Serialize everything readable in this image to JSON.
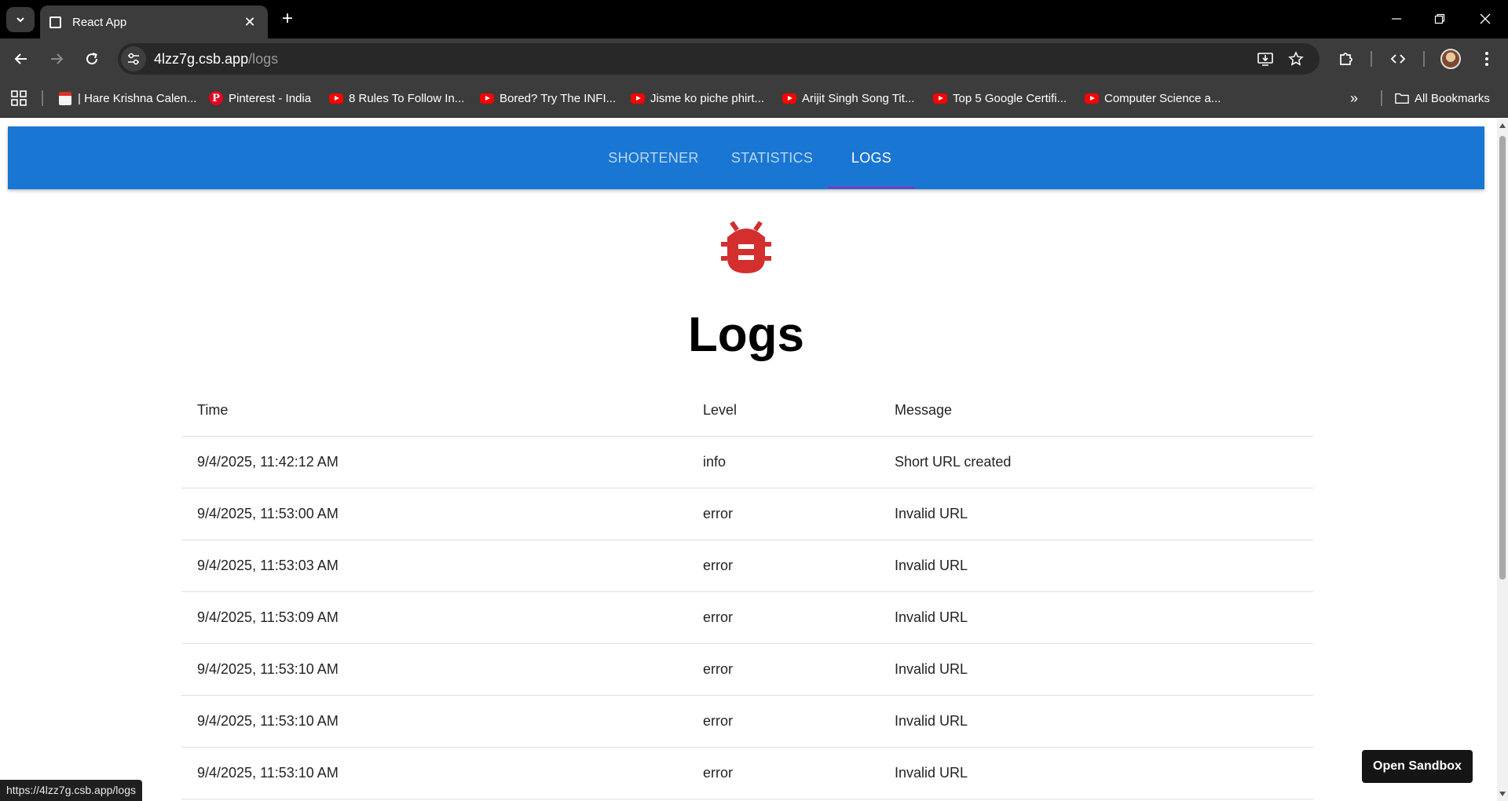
{
  "browser": {
    "tab_title": "React App",
    "url_host": "4lzz7g.csb.app",
    "url_path": "/logs",
    "status_url": "https://4lzz7g.csb.app/logs",
    "bookmarks": [
      {
        "label": "| Hare Krishna Calen...",
        "icon": "calendar-icon"
      },
      {
        "label": "Pinterest - India",
        "icon": "pinterest-icon"
      },
      {
        "label": "8 Rules To Follow In...",
        "icon": "youtube-icon"
      },
      {
        "label": "Bored? Try The INFI...",
        "icon": "youtube-icon"
      },
      {
        "label": "Jisme ko piche phirt...",
        "icon": "youtube-icon"
      },
      {
        "label": "Arijit Singh Song Tit...",
        "icon": "youtube-icon"
      },
      {
        "label": "Top 5 Google Certifi...",
        "icon": "youtube-icon"
      },
      {
        "label": "Computer Science a...",
        "icon": "youtube-icon"
      }
    ],
    "all_bookmarks": "All Bookmarks"
  },
  "nav": {
    "tabs": [
      {
        "label": "SHORTENER",
        "active": false
      },
      {
        "label": "STATISTICS",
        "active": false
      },
      {
        "label": "LOGS",
        "active": true
      }
    ],
    "accent_color": "#1976d2",
    "indicator_color": "#9c27b0"
  },
  "page": {
    "icon": "bug-report-icon",
    "icon_color": "#d32f2f",
    "title": "Logs"
  },
  "table": {
    "headers": [
      "Time",
      "Level",
      "Message"
    ],
    "rows": [
      [
        "9/4/2025, 11:42:12 AM",
        "info",
        "Short URL created"
      ],
      [
        "9/4/2025, 11:53:00 AM",
        "error",
        "Invalid URL"
      ],
      [
        "9/4/2025, 11:53:03 AM",
        "error",
        "Invalid URL"
      ],
      [
        "9/4/2025, 11:53:09 AM",
        "error",
        "Invalid URL"
      ],
      [
        "9/4/2025, 11:53:10 AM",
        "error",
        "Invalid URL"
      ],
      [
        "9/4/2025, 11:53:10 AM",
        "error",
        "Invalid URL"
      ],
      [
        "9/4/2025, 11:53:10 AM",
        "error",
        "Invalid URL"
      ]
    ]
  },
  "sandbox_button": "Open Sandbox"
}
